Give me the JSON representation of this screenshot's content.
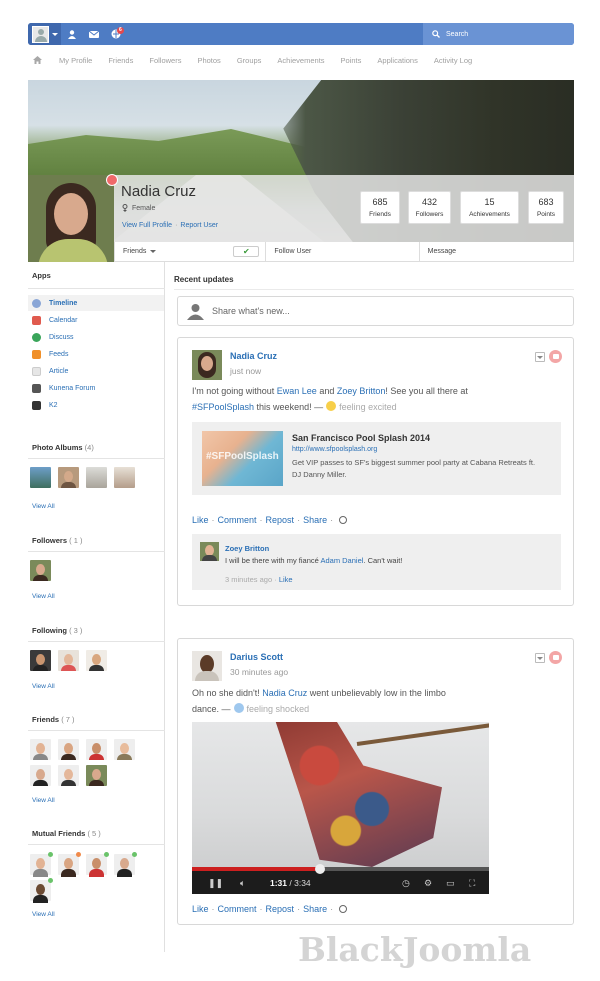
{
  "toolbar": {
    "notification_count": "6",
    "search_placeholder": "Search"
  },
  "nav": {
    "items": [
      "My Profile",
      "Friends",
      "Followers",
      "Photos",
      "Groups",
      "Achievements",
      "Points",
      "Applications",
      "Activity Log"
    ]
  },
  "profile": {
    "name": "Nadia Cruz",
    "gender": "Female",
    "view_full_profile": "View Full Profile",
    "link_separator": "·",
    "report_user": "Report User",
    "stats": [
      {
        "value": "685",
        "label": "Friends"
      },
      {
        "value": "432",
        "label": "Followers"
      },
      {
        "value": "15",
        "label": "Achievements"
      },
      {
        "value": "683",
        "label": "Points"
      }
    ],
    "bar": {
      "friends_label": "Friends",
      "follow_label": "Follow User",
      "message_label": "Message"
    }
  },
  "sidebar": {
    "apps_heading": "Apps",
    "apps": [
      {
        "label": "Timeline",
        "color": "#8aa6d6"
      },
      {
        "label": "Calendar",
        "color": "#e05a4e"
      },
      {
        "label": "Discuss",
        "color": "#3aa55a"
      },
      {
        "label": "Feeds",
        "color": "#f0902a"
      },
      {
        "label": "Article",
        "color": "#d0d0d0"
      },
      {
        "label": "Kunena Forum",
        "color": "#555555"
      },
      {
        "label": "K2",
        "color": "#333333"
      }
    ],
    "sections": [
      {
        "title": "Photo Albums",
        "count": "(4)",
        "view_all": "View All"
      },
      {
        "title": "Followers",
        "count": "( 1 )",
        "view_all": "View All"
      },
      {
        "title": "Following",
        "count": "( 3 )",
        "view_all": "View All"
      },
      {
        "title": "Friends",
        "count": "( 7 )",
        "view_all": "View All"
      },
      {
        "title": "Mutual Friends",
        "count": "( 5 )",
        "view_all": "View All"
      }
    ]
  },
  "main": {
    "recent_title": "Recent updates",
    "share_placeholder": "Share what's new...",
    "post1": {
      "author": "Nadia Cruz",
      "time": "just now",
      "text_1": "I'm not going without ",
      "mention_1": "Ewan Lee",
      "text_2": " and ",
      "mention_2": "Zoey Britton",
      "text_3": "! See you all there at",
      "hashtag": "#SFPoolSplash",
      "text_4": " this weekend! —",
      "feeling": "feeling excited",
      "link": {
        "image_text": "#SFPoolSplash",
        "title": "San Francisco Pool Splash 2014",
        "url": "http://www.sfpoolsplash.org",
        "desc": "Get VIP passes to SF's biggest summer pool party at Cabana Retreats ft. DJ Danny Miller."
      },
      "actions": [
        "Like",
        "Comment",
        "Repost",
        "Share"
      ],
      "action_sep": "·",
      "comment": {
        "author": "Zoey Britton",
        "text_1": "I will be there with my fiancé ",
        "mention": "Adam Daniel",
        "text_2": ". Can't wait!",
        "time": "3 minutes ago",
        "meta_sep": "·",
        "like": "Like"
      }
    },
    "post2": {
      "author": "Darius Scott",
      "time": "30 minutes ago",
      "text_1": "Oh no she didn't! ",
      "mention": "Nadia Cruz",
      "text_2": " went unbelievably low in the limbo",
      "text_3": "dance. —",
      "feeling": "feeling shocked",
      "video": {
        "current": "1:31",
        "duration": "/ 3:34",
        "progress": 0.43
      },
      "actions": [
        "Like",
        "Comment",
        "Repost",
        "Share"
      ],
      "action_sep": "·"
    }
  },
  "watermark": "BlackJoomla"
}
